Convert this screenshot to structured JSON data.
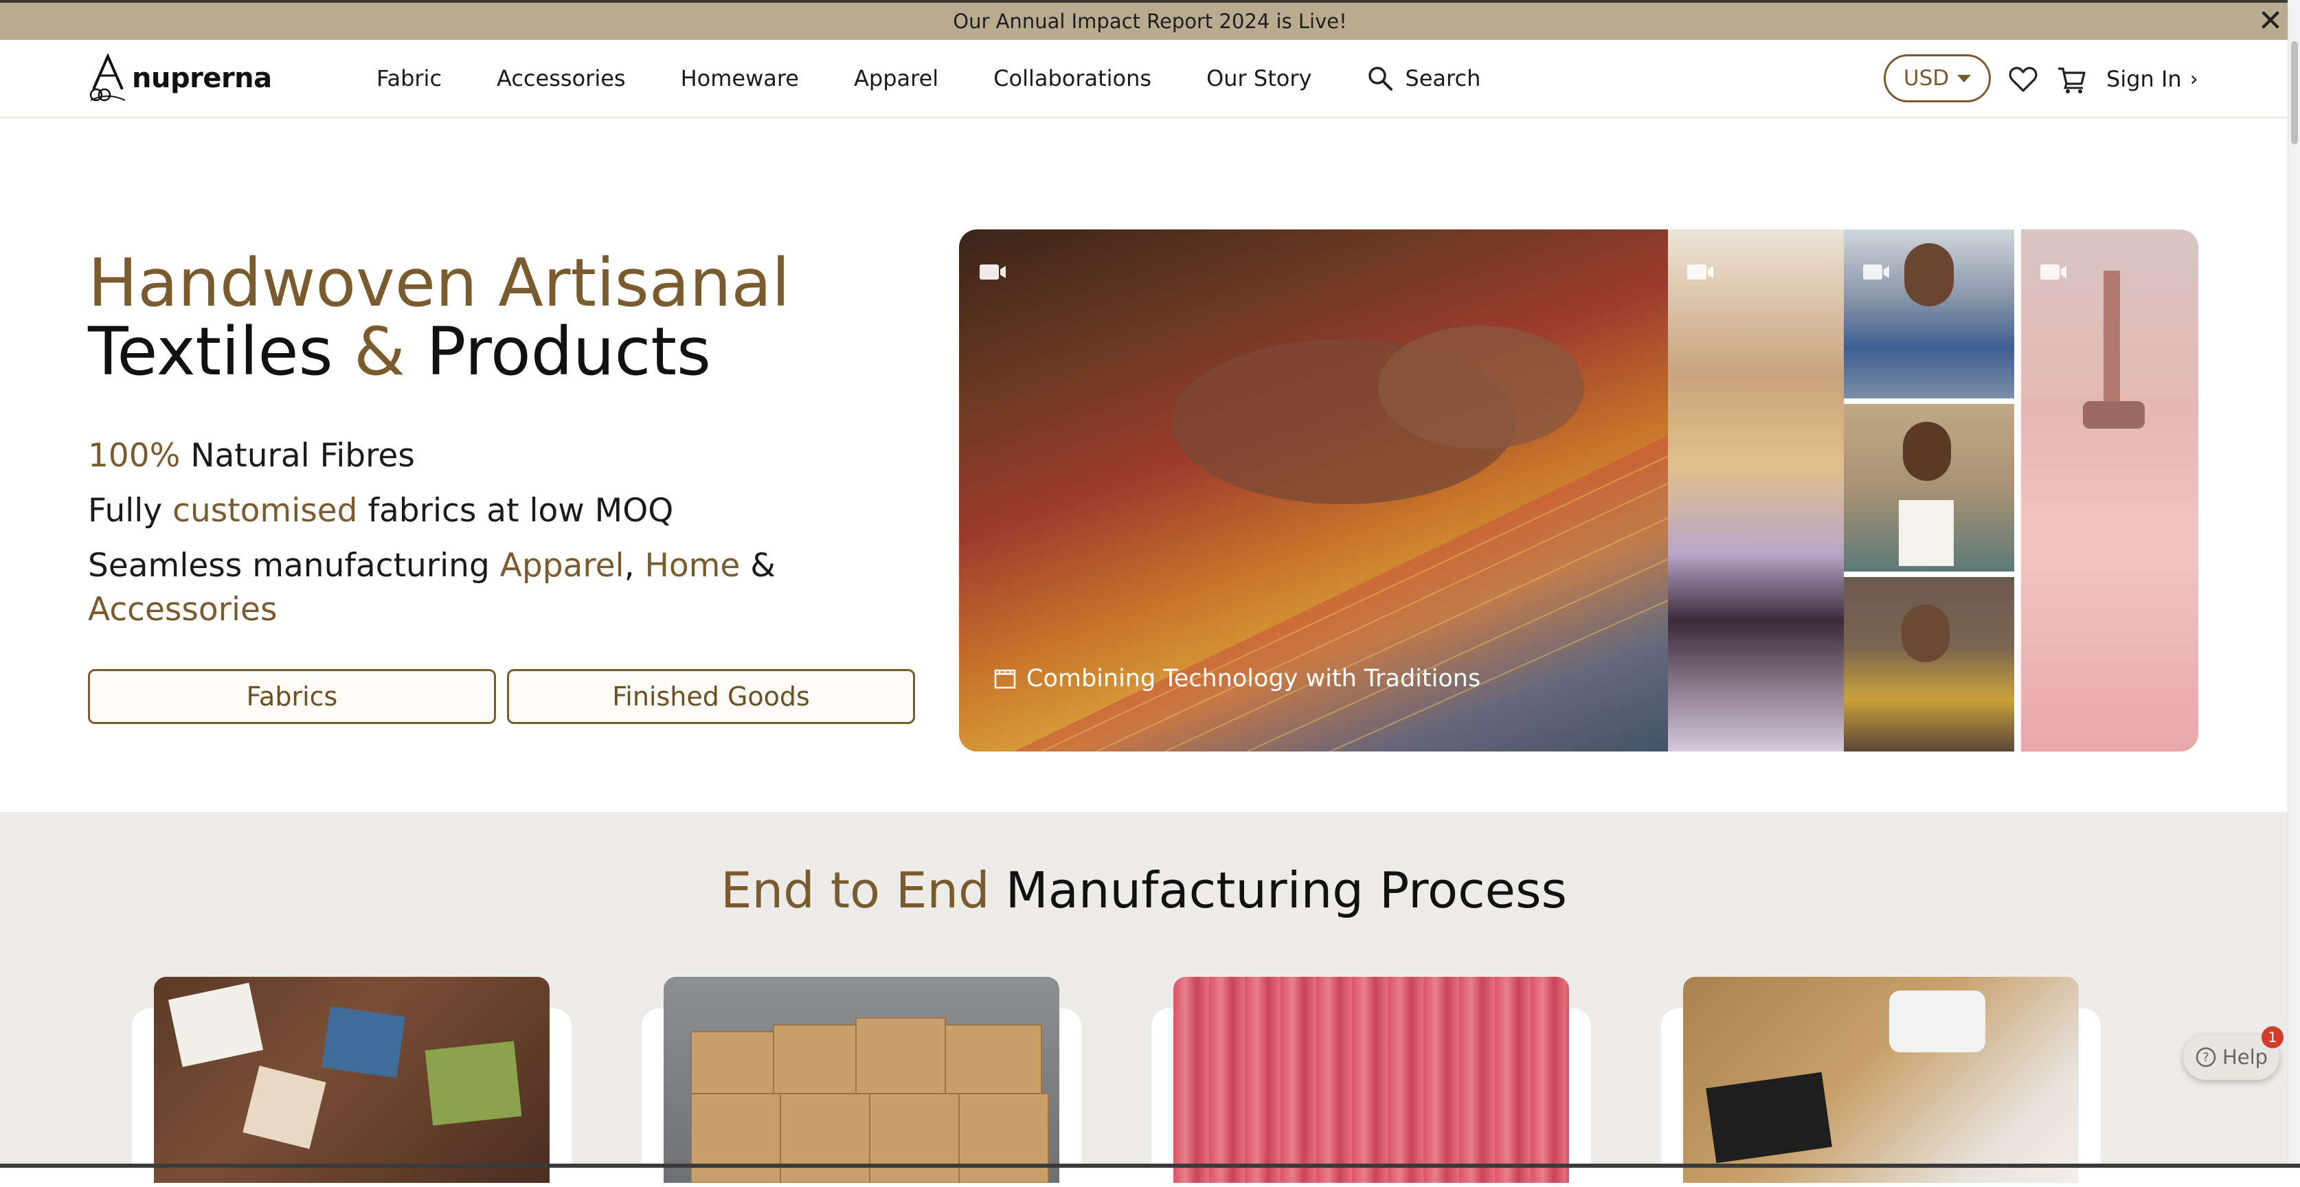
{
  "announcement": {
    "text": "Our Annual Impact Report 2024 is Live!",
    "close": "✕"
  },
  "header": {
    "brand": "nuprerna",
    "nav": [
      "Fabric",
      "Accessories",
      "Homeware",
      "Apparel",
      "Collaborations",
      "Our Story"
    ],
    "search_label": "Search",
    "currency": "USD",
    "signin_label": "Sign In",
    "icons": [
      "search-icon",
      "wishlist-heart-icon",
      "cart-icon",
      "chevron-right-icon"
    ]
  },
  "hero": {
    "title_line1": "Handwoven Artisanal",
    "title_line2_a": "Textiles ",
    "title_line2_amp": "&",
    "title_line2_b": " Products",
    "line1_accent": "100%",
    "line1_rest": " Natural Fibres",
    "line2_a": "Fully ",
    "line2_accent": "customised",
    "line2_b": " fabrics at low MOQ",
    "line3_a": "Seamless manufacturing ",
    "line3_apparel": "Apparel",
    "line3_comma": ", ",
    "line3_home": "Home",
    "line3_amp": " &",
    "line3_accessories": "Accessories",
    "btn_fabrics": "Fabrics",
    "btn_finished": "Finished Goods"
  },
  "media": {
    "caption": "Combining Technology with Traditions",
    "icons": [
      "video-icon",
      "clapperboard-icon"
    ]
  },
  "process": {
    "title_accent": "End to End",
    "title_rest": " Manufacturing Process"
  },
  "help": {
    "label": "Help",
    "badge": "1"
  },
  "colors": {
    "accent": "#7a5b2e",
    "announcement_bg": "#b9ab8f",
    "section_bg": "#eeece8"
  }
}
